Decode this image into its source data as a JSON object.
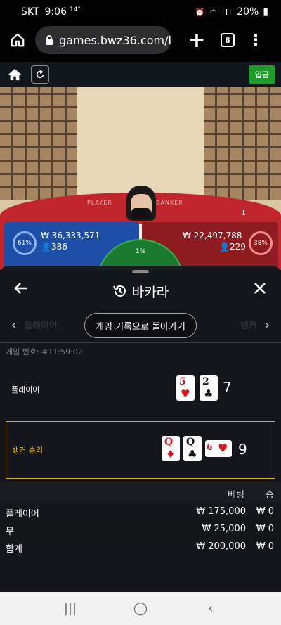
{
  "status_bar": {
    "carrier": "SKT",
    "time": "9:06",
    "temperature": "14°",
    "battery": "20%"
  },
  "browser": {
    "url": "games.bwz36.com/l",
    "tab_count": "8"
  },
  "game_header": {
    "deposit_label": "입금"
  },
  "video": {
    "table_label_player": "PLAYER",
    "table_label_banker": "BANKER",
    "shoe_number": "1"
  },
  "bets_overlay": {
    "player_pct": "61%",
    "player_amount": "₩ 36,333,571",
    "player_count": "386",
    "banker_pct": "38%",
    "banker_amount": "₩ 22,497,788",
    "banker_count": "229",
    "tie_pct": "1%"
  },
  "sheet": {
    "title": "바카라",
    "return_button": "게임 기록으로 돌아가기",
    "round_number": "게임 번호: #11:59:02",
    "ghost_left": "플레이어",
    "ghost_right": "뱅커",
    "player": {
      "label": "플레이어",
      "cards": [
        {
          "rank": "5",
          "suit": "♥",
          "color": "#d8141c"
        },
        {
          "rank": "2",
          "suit": "♣",
          "color": "#111111"
        }
      ],
      "total": "7"
    },
    "banker": {
      "label": "뱅커 승리",
      "cards": [
        {
          "rank": "Q",
          "suit": "♦",
          "color": "#d8141c"
        },
        {
          "rank": "Q",
          "suit": "♣",
          "color": "#111111"
        },
        {
          "rank": "6",
          "suit": "♥",
          "color": "#d8141c",
          "sideways": true
        }
      ],
      "total": "9"
    },
    "bet_table": {
      "headers": [
        "베팅",
        "승"
      ],
      "rows": [
        {
          "name": "플레이어",
          "bet": "₩ 175,000",
          "win": "₩ 0"
        },
        {
          "name": "무",
          "bet": "₩ 25,000",
          "win": "₩ 0"
        },
        {
          "name": "합계",
          "bet": "₩ 200,000",
          "win": "₩ 0"
        }
      ]
    }
  },
  "colors": {
    "winner_highlight": "#d4b415",
    "deposit_green": "#1f9b2c",
    "player_blue": "#1e4fa8",
    "banker_red": "#8e1b1f"
  }
}
